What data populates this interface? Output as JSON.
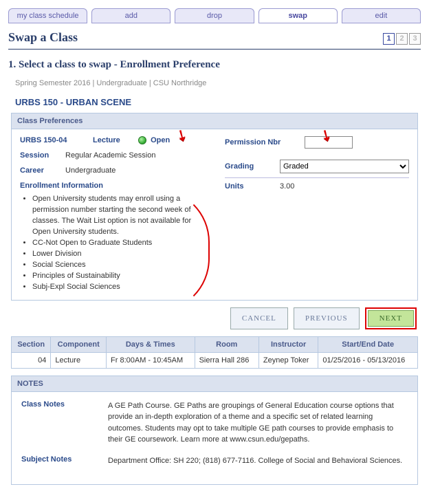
{
  "tabs": [
    {
      "label": "my class schedule",
      "active": false
    },
    {
      "label": "add",
      "active": false
    },
    {
      "label": "drop",
      "active": false
    },
    {
      "label": "swap",
      "active": true
    },
    {
      "label": "edit",
      "active": false
    }
  ],
  "page_title": "Swap a Class",
  "steps": {
    "current": "1",
    "others": [
      "2",
      "3"
    ]
  },
  "heading": "1.  Select a class to swap - Enrollment  Preference",
  "context": "Spring Semester 2016 | Undergraduate | CSU Northridge",
  "class_name": "URBS  150 - URBAN SCENE",
  "panel_prefs_title": "Class Preferences",
  "prefs": {
    "class_link": "URBS 150-04",
    "component": "Lecture",
    "status": "Open",
    "session_label": "Session",
    "session_value": "Regular Academic Session",
    "career_label": "Career",
    "career_value": "Undergraduate",
    "perm_label": "Permission Nbr",
    "perm_value": "",
    "grading_label": "Grading",
    "grading_value": "Graded",
    "units_label": "Units",
    "units_value": "3.00"
  },
  "enrollment_info": {
    "title": "Enrollment Information",
    "items": [
      "Open University students may enroll using a permission number starting the second week of classes. The Wait List option is not available for Open University students.",
      "CC-Not Open to Graduate Students",
      "Lower Division",
      "Social Sciences",
      "Principles of Sustainability",
      "Subj-Expl Social Sciences"
    ]
  },
  "buttons": {
    "cancel": "Cancel",
    "previous": "Previous",
    "next": "Next"
  },
  "schedule": {
    "headers": [
      "Section",
      "Component",
      "Days & Times",
      "Room",
      "Instructor",
      "Start/End Date"
    ],
    "rows": [
      {
        "section": "04",
        "component": "Lecture",
        "days_times": "Fr 8:00AM - 10:45AM",
        "room": "Sierra Hall 286",
        "instructor": "Zeynep Toker",
        "dates": "01/25/2016 - 05/13/2016"
      }
    ]
  },
  "notes_panel_title": "NOTES",
  "notes": {
    "class_label": "Class Notes",
    "class_text": "A GE Path Course. GE Paths are groupings of General Education course options that provide an in-depth exploration of a theme and a specific set of related learning outcomes. Students may opt to take multiple GE path courses to provide emphasis to their GE coursework. Learn more at www.csun.edu/gepaths.",
    "subject_label": "Subject Notes",
    "subject_text": "Department Office: SH 220; (818) 677-7116. College of Social and Behavioral Sciences."
  }
}
